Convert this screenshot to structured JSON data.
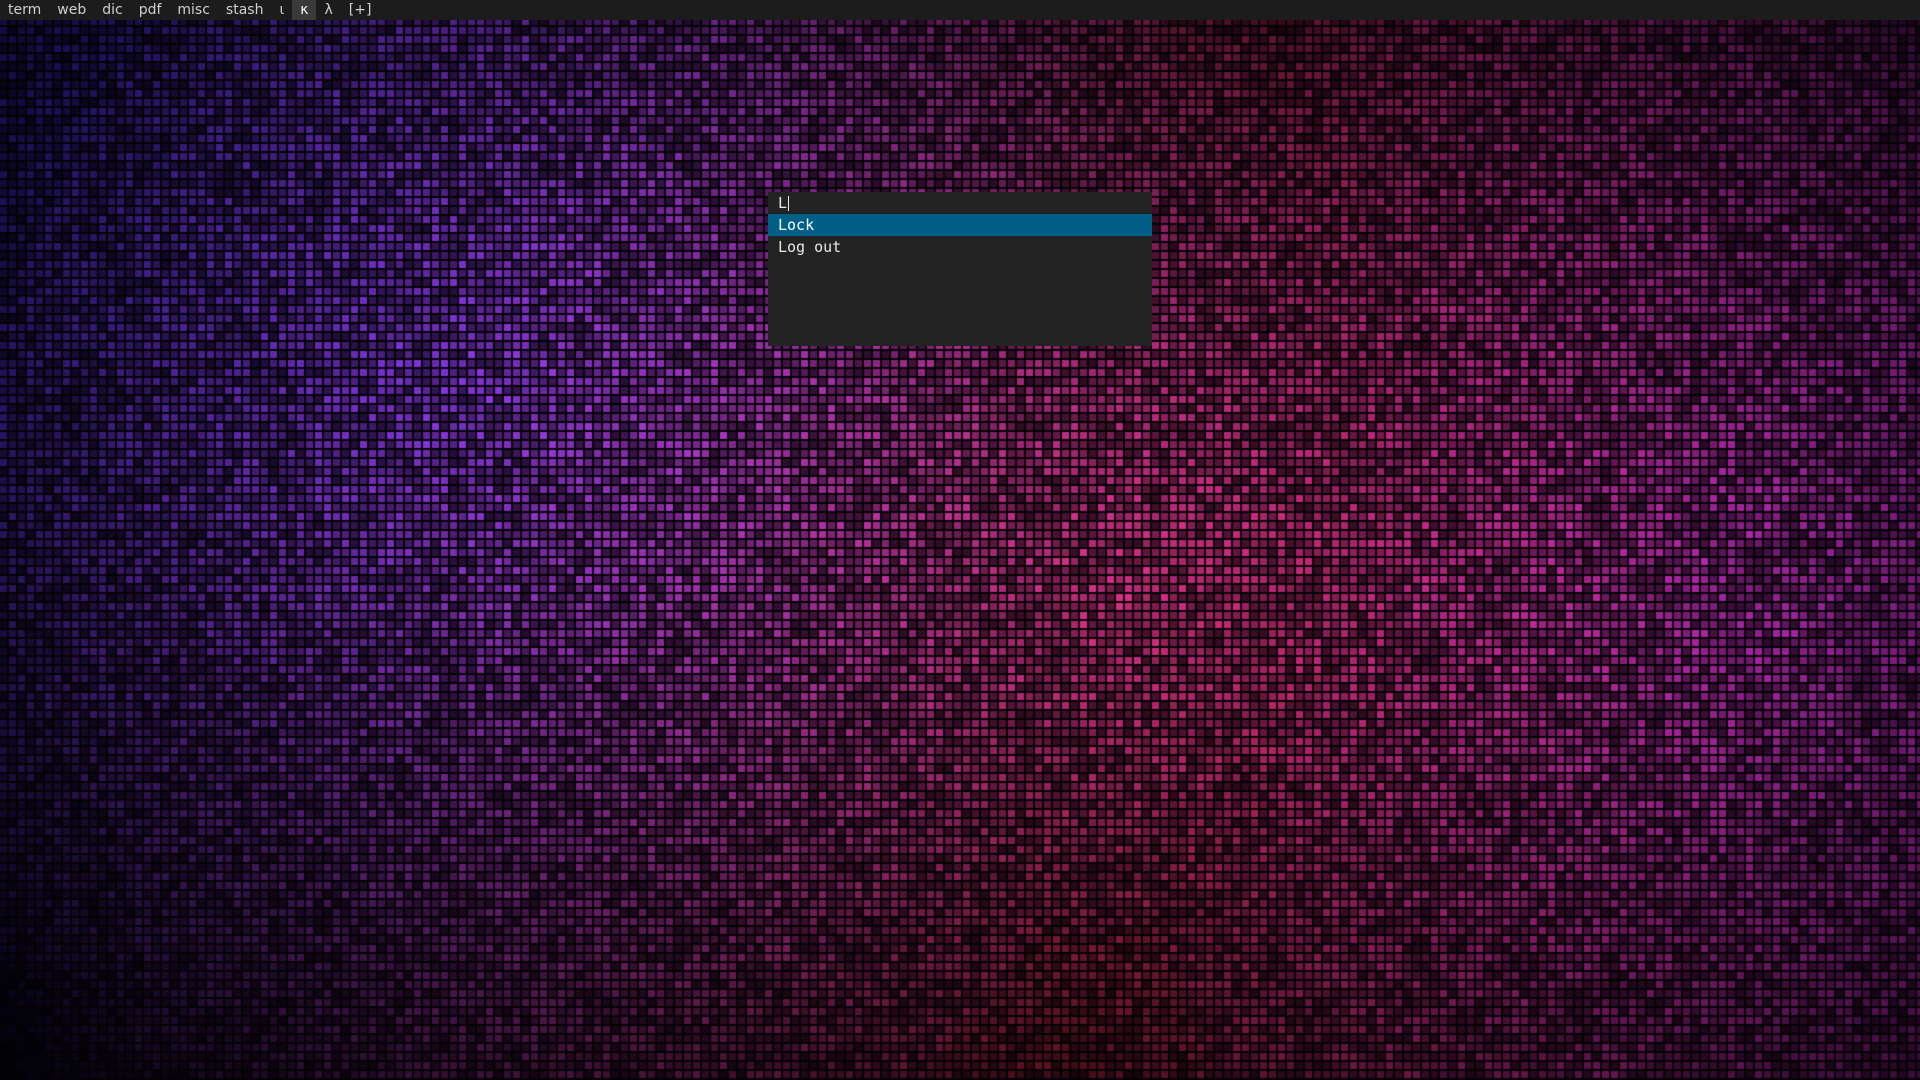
{
  "workspaces": [
    {
      "label": "term",
      "active": false
    },
    {
      "label": "web",
      "active": false
    },
    {
      "label": "dic",
      "active": false
    },
    {
      "label": "pdf",
      "active": false
    },
    {
      "label": "misc",
      "active": false
    },
    {
      "label": "stash",
      "active": false
    },
    {
      "label": "ι",
      "active": false
    },
    {
      "label": "κ",
      "active": true
    },
    {
      "label": "λ",
      "active": false
    },
    {
      "label": "[+]",
      "active": false
    }
  ],
  "launcher": {
    "query": "L",
    "results": [
      {
        "label": "Lock",
        "selected": true
      },
      {
        "label": "Log out",
        "selected": false
      }
    ]
  },
  "colors": {
    "topbar_bg": "#1c1c1c",
    "launcher_bg": "#232323",
    "selection_bg": "#005f87",
    "text": "#e8e8e8"
  }
}
